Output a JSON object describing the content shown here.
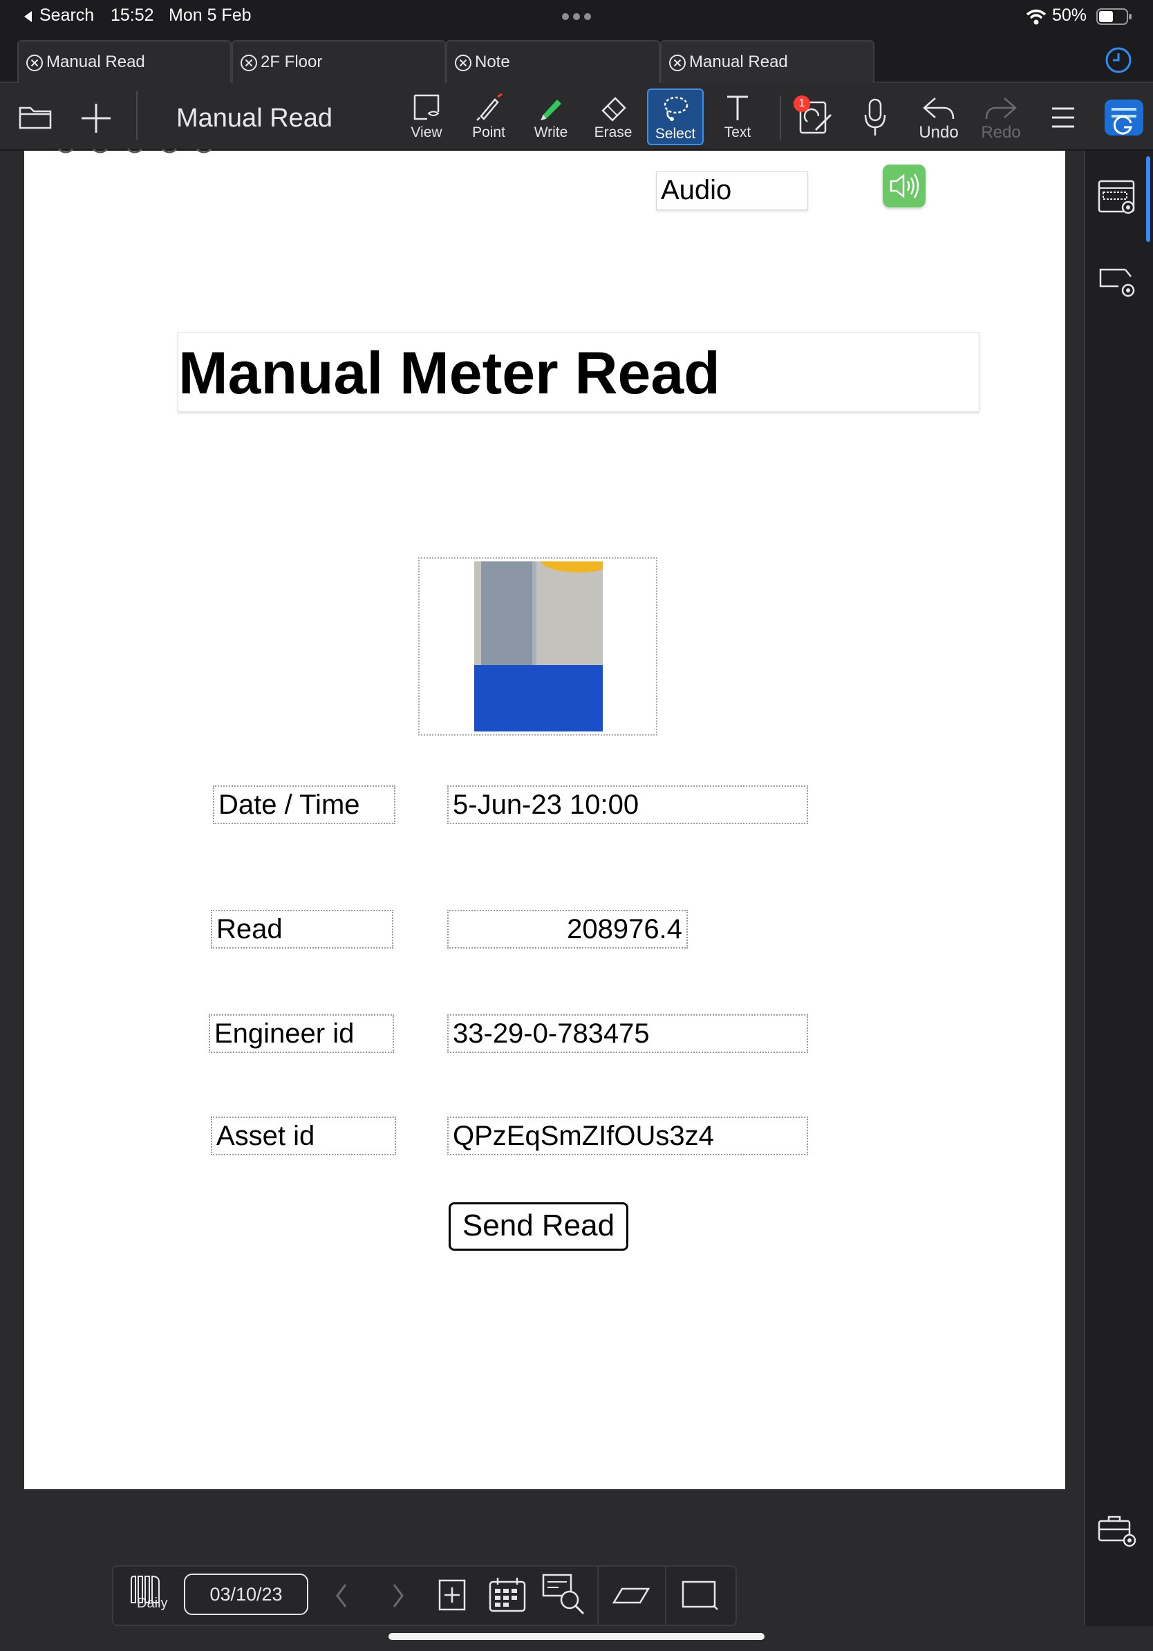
{
  "status_bar": {
    "back_label": "Search",
    "time": "15:52",
    "date": "Mon 5 Feb",
    "battery": "50%"
  },
  "tabs": [
    {
      "label": "Manual Read"
    },
    {
      "label": "2F Floor"
    },
    {
      "label": "Note"
    },
    {
      "label": "Manual Read"
    }
  ],
  "toolbar": {
    "doc_title": "Manual Read",
    "tools": {
      "view": "View",
      "point": "Point",
      "write": "Write",
      "erase": "Erase",
      "select": "Select",
      "text": "Text"
    },
    "badge_count": "1",
    "undo": "Undo",
    "redo": "Redo",
    "active_tool": "Select",
    "accent": "#1e4f8c"
  },
  "page": {
    "audio_label": "Audio",
    "title": "Manual Meter Read",
    "fields": [
      {
        "label": "Date / Time",
        "value": "5-Jun-23 10:00"
      },
      {
        "label": "Read",
        "value": "208976.4"
      },
      {
        "label": "Engineer id",
        "value": "33-29-0-783475"
      },
      {
        "label": "Asset id",
        "value": "QPzEqSmZIfOUs3z4"
      }
    ],
    "send_button": "Send Read"
  },
  "bottom_bar": {
    "daily_label": "Daily",
    "date": "03/10/23"
  },
  "colors": {
    "audio_button": "#6cc767",
    "app_icon": "#1d6fd8"
  }
}
